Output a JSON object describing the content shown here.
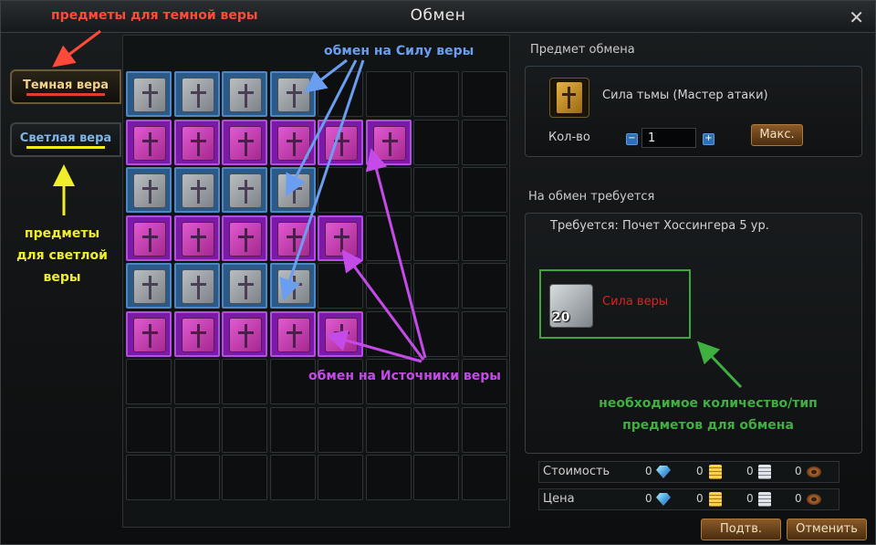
{
  "window": {
    "title": "Обмен",
    "close_glyph": "✕"
  },
  "annotations": {
    "dark_items": "предметы для темной веры",
    "light_items": [
      "предметы",
      "для светлой",
      "веры"
    ],
    "faith_power": "обмен на Силу веры",
    "faith_sources": "обмен на Источники веры",
    "required": [
      "необходимое количество/тип",
      "предметов для обмена"
    ]
  },
  "tabs": [
    {
      "label": "Темная вера",
      "active": true
    },
    {
      "label": "Светлая вера",
      "active": false
    }
  ],
  "grid": {
    "cols": 8,
    "rows": [
      [
        "blue",
        "blue",
        "blue",
        "blue",
        "",
        "",
        "",
        ""
      ],
      [
        "purple",
        "purple",
        "purple",
        "purple",
        "purple",
        "purple",
        "",
        ""
      ],
      [
        "blue",
        "blue",
        "blue",
        "blue",
        "",
        "",
        "",
        ""
      ],
      [
        "purple",
        "purple",
        "purple",
        "purple",
        "purple",
        "",
        "",
        ""
      ],
      [
        "blue",
        "blue",
        "blue",
        "blue",
        "",
        "",
        "",
        ""
      ],
      [
        "purple",
        "purple",
        "purple",
        "purple",
        "purple",
        "",
        "",
        ""
      ],
      [
        "",
        "",
        "",
        "",
        "",
        "",
        "",
        ""
      ],
      [
        "",
        "",
        "",
        "",
        "",
        "",
        "",
        ""
      ],
      [
        "",
        "",
        "",
        "",
        "",
        "",
        "",
        ""
      ]
    ]
  },
  "exchange": {
    "section_title": "Предмет обмена",
    "item_name": "Сила тьмы (Мастер атаки)",
    "qty_label": "Кол-во",
    "qty_value": "1",
    "minus": "−",
    "plus": "+",
    "max_button": "Макс."
  },
  "required": {
    "section_title": "На обмен требуется",
    "requirement_text": "Требуется: Почет Хоссингера 5 ур.",
    "item_count": "20",
    "item_name": "Сила веры",
    "item_color": "#e02020"
  },
  "costs": [
    {
      "label": "Стоимость",
      "values": [
        "0",
        "0",
        "0",
        "0"
      ]
    },
    {
      "label": "Цена",
      "values": [
        "0",
        "0",
        "0",
        "0"
      ]
    }
  ],
  "buttons": {
    "confirm": "Подтв.",
    "cancel": "Отменить"
  },
  "colors": {
    "accent_red": "#ff4a3a",
    "accent_yellow": "#f0ee2a",
    "accent_blue": "#6a9ef0",
    "accent_purple": "#c44be8",
    "accent_green": "#3fb040"
  }
}
